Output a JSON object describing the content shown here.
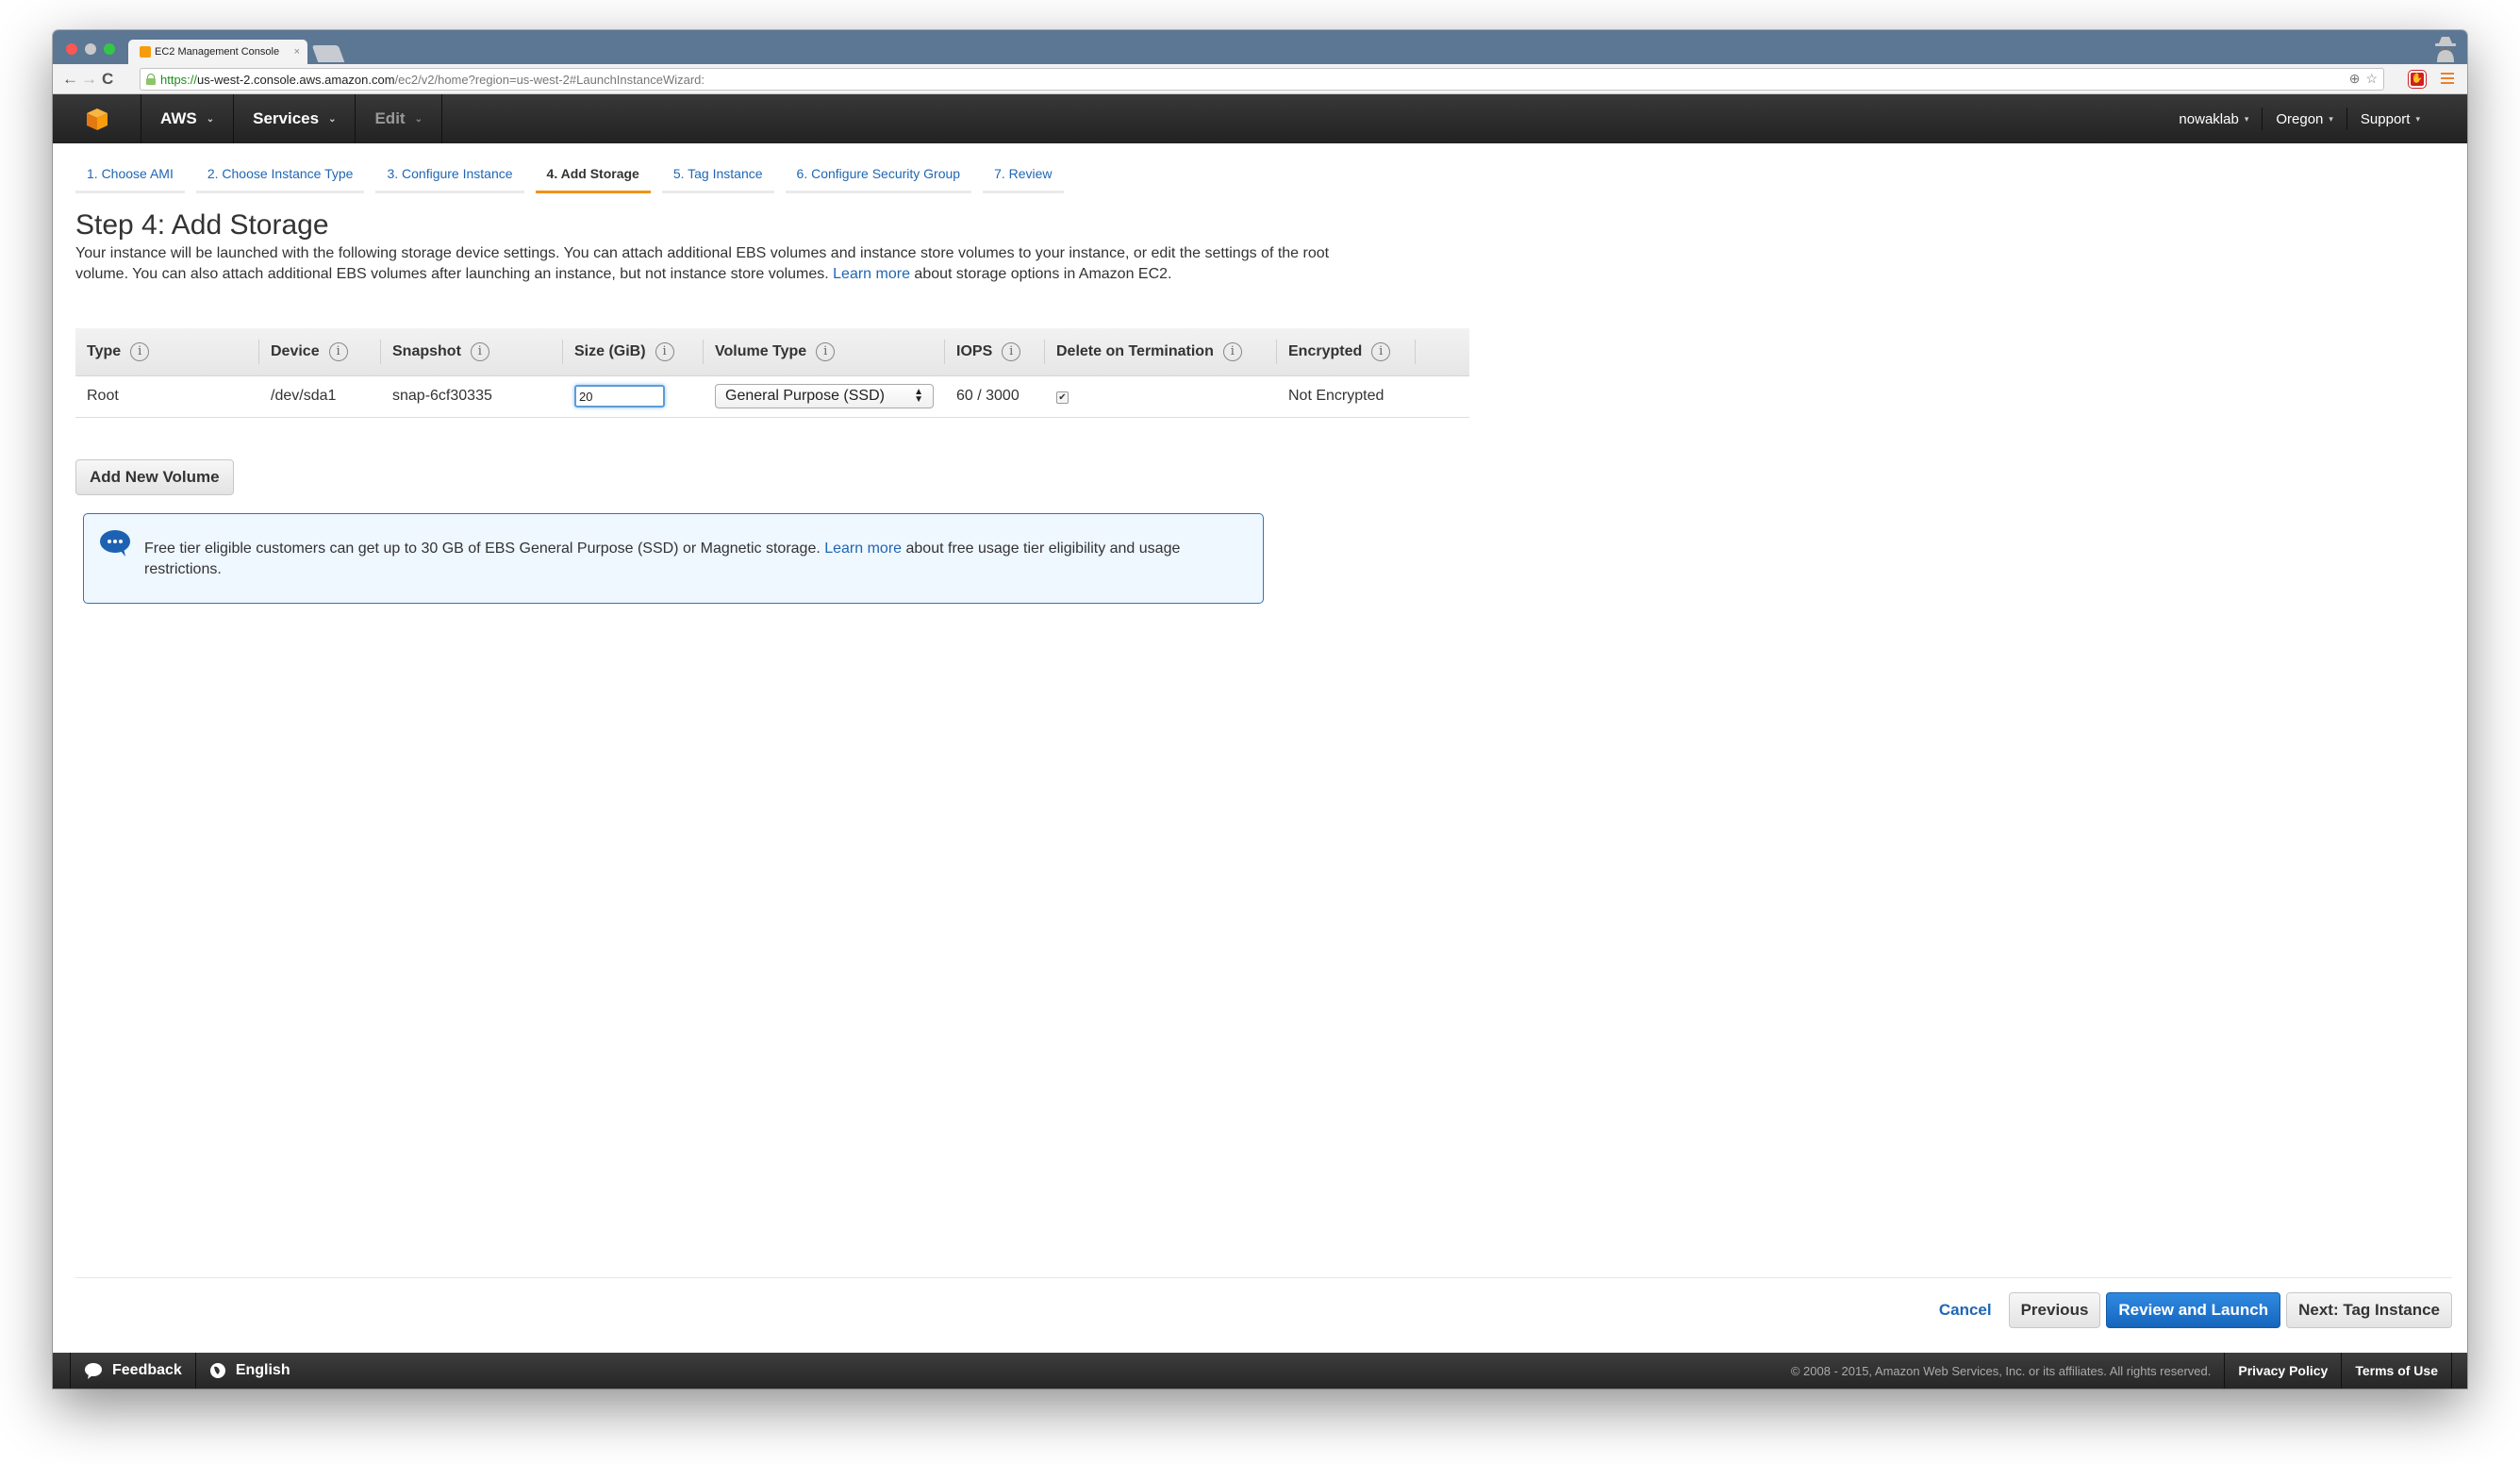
{
  "browser": {
    "tab_title": "EC2 Management Console",
    "tab_close": "×",
    "url_scheme": "https://",
    "url_host": "us-west-2.console.aws.amazon.com",
    "url_path": "/ec2/v2/home?region=us-west-2#LaunchInstanceWizard:",
    "nav_back": "←",
    "nav_forward": "→",
    "nav_reload": "C",
    "zoom_icon": "⊕",
    "bookmark_icon": "☆",
    "adblock_icon": "✋"
  },
  "header": {
    "aws_label": "AWS",
    "services_label": "Services",
    "edit_label": "Edit",
    "caret": "⌄",
    "account": "nowaklab",
    "region": "Oregon",
    "support": "Support",
    "small_caret": "▾"
  },
  "steps": [
    {
      "label": "1. Choose AMI",
      "active": false
    },
    {
      "label": "2. Choose Instance Type",
      "active": false
    },
    {
      "label": "3. Configure Instance",
      "active": false
    },
    {
      "label": "4. Add Storage",
      "active": true
    },
    {
      "label": "5. Tag Instance",
      "active": false
    },
    {
      "label": "6. Configure Security Group",
      "active": false
    },
    {
      "label": "7. Review",
      "active": false
    }
  ],
  "main": {
    "title": "Step 4: Add Storage",
    "intro_before": "Your instance will be launched with the following storage device settings. You can attach additional EBS volumes and instance store volumes to your instance, or edit the settings of the root volume. You can also attach additional EBS volumes after launching an instance, but not instance store volumes. ",
    "intro_link": "Learn more",
    "intro_after": " about storage options in Amazon EC2."
  },
  "table": {
    "info_glyph": "i",
    "columns": [
      "Type",
      "Device",
      "Snapshot",
      "Size (GiB)",
      "Volume Type",
      "IOPS",
      "Delete on Termination",
      "Encrypted"
    ],
    "rows": [
      {
        "type": "Root",
        "device": "/dev/sda1",
        "snapshot": "snap-6cf30335",
        "size": "20",
        "volume_type": "General Purpose (SSD)",
        "iops": "60 / 3000",
        "delete_on_termination": true,
        "check_glyph": "✔",
        "encrypted": "Not Encrypted"
      }
    ]
  },
  "add_volume_label": "Add New Volume",
  "free_tier": {
    "before": "Free tier eligible customers can get up to 30 GB of EBS General Purpose (SSD) or Magnetic storage. ",
    "link": "Learn more",
    "after": " about free usage tier eligibility and usage restrictions."
  },
  "actions": {
    "cancel": "Cancel",
    "previous": "Previous",
    "review_launch": "Review and Launch",
    "next": "Next: Tag Instance"
  },
  "footer": {
    "feedback": "Feedback",
    "language": "English",
    "copyright": "© 2008 - 2015, Amazon Web Services, Inc. or its affiliates. All rights reserved.",
    "privacy": "Privacy Policy",
    "terms": "Terms of Use"
  },
  "colors": {
    "accent_orange": "#f0921a",
    "link_blue": "#1f66b3",
    "primary_button": "#1f75cb",
    "header_dark": "#2b2b2b"
  }
}
